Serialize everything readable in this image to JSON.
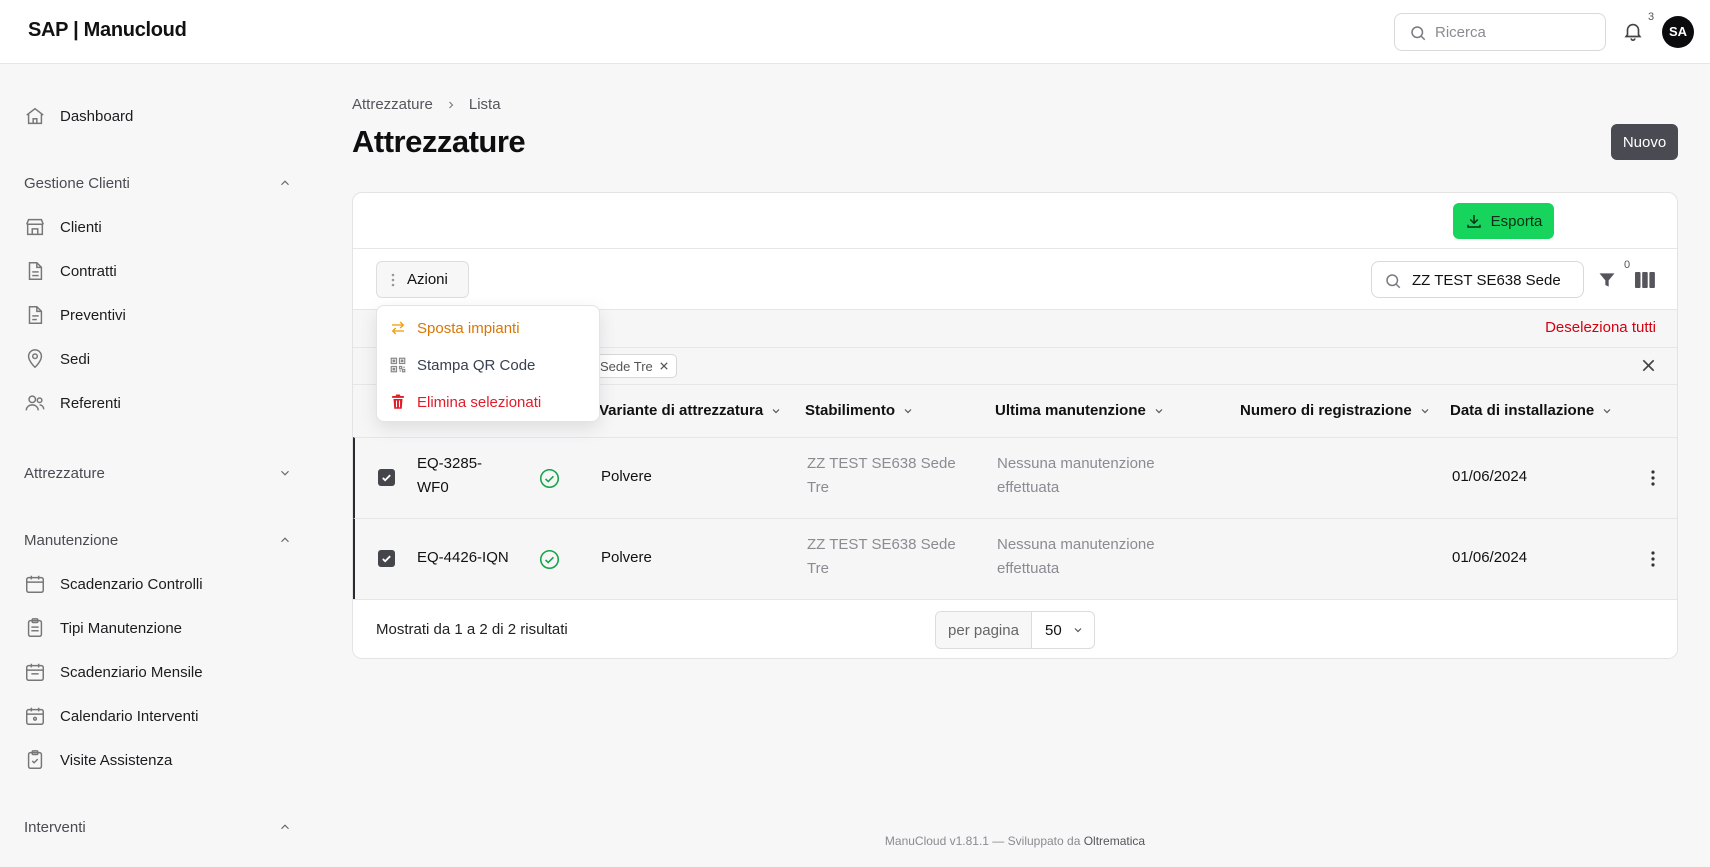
{
  "app": {
    "logo": "SAP | Manucloud"
  },
  "topbar": {
    "search_placeholder": "Ricerca",
    "notifications_count": "3",
    "avatar_initials": "SA"
  },
  "sidebar": {
    "dashboard": "Dashboard",
    "groups": {
      "gestione_clienti": "Gestione Clienti",
      "attrezzature": "Attrezzature",
      "manutenzione": "Manutenzione",
      "interventi": "Interventi"
    },
    "clienti_items": [
      "Clienti",
      "Contratti",
      "Preventivi",
      "Sedi",
      "Referenti"
    ],
    "manutenzione_items": [
      "Scadenzario Controlli",
      "Tipi Manutenzione",
      "Scadenziario Mensile",
      "Calendario Interventi",
      "Visite Assistenza"
    ]
  },
  "breadcrumb": [
    "Attrezzature",
    "Lista"
  ],
  "page": {
    "title": "Attrezzature",
    "new_button": "Nuovo"
  },
  "toolbar": {
    "export_label": "Esporta",
    "actions_label": "Azioni",
    "search_value": "ZZ TEST SE638 Sede",
    "filter_count": "0",
    "deselect_all": "Deseleziona tutti",
    "chip_label": "Sede Tre"
  },
  "actions_menu": [
    {
      "label": "Sposta impianti",
      "color": "#d97706",
      "icon": "swap-arrows-icon"
    },
    {
      "label": "Stampa QR Code",
      "color": "#374151",
      "icon": "qr-code-icon"
    },
    {
      "label": "Elimina selezionati",
      "color": "#e11d2a",
      "icon": "trash-icon"
    }
  ],
  "table": {
    "columns": [
      "Variante di attrezzatura",
      "Stabilimento",
      "Ultima manutenzione",
      "Numero di registrazione",
      "Data di installazione"
    ],
    "rows": [
      {
        "code_line1": "EQ-3285-",
        "code_line2": "WF0",
        "selected": true,
        "status": "ok",
        "variant": "Polvere",
        "plant_line1": "ZZ TEST SE638 Sede",
        "plant_line2": "Tre",
        "last_line1": "Nessuna manutenzione",
        "last_line2": "effettuata",
        "reg_number": "",
        "install_date": "01/06/2024"
      },
      {
        "code_line1": "EQ-4426-IQN",
        "code_line2": "",
        "selected": true,
        "status": "ok",
        "variant": "Polvere",
        "plant_line1": "ZZ TEST SE638 Sede",
        "plant_line2": "Tre",
        "last_line1": "Nessuna manutenzione",
        "last_line2": "effettuata",
        "reg_number": "",
        "install_date": "01/06/2024"
      }
    ]
  },
  "pagination": {
    "results_text": "Mostrati da 1 a 2 di 2 risultati",
    "per_page_label": "per pagina",
    "per_page_value": "50"
  },
  "footer": {
    "version_text": "ManuCloud v1.81.1 — Sviluppato da",
    "developer": "Oltrematica"
  },
  "colors": {
    "export_green": "#16d45c",
    "danger_red": "#d6000f",
    "status_green": "#16a34a"
  }
}
